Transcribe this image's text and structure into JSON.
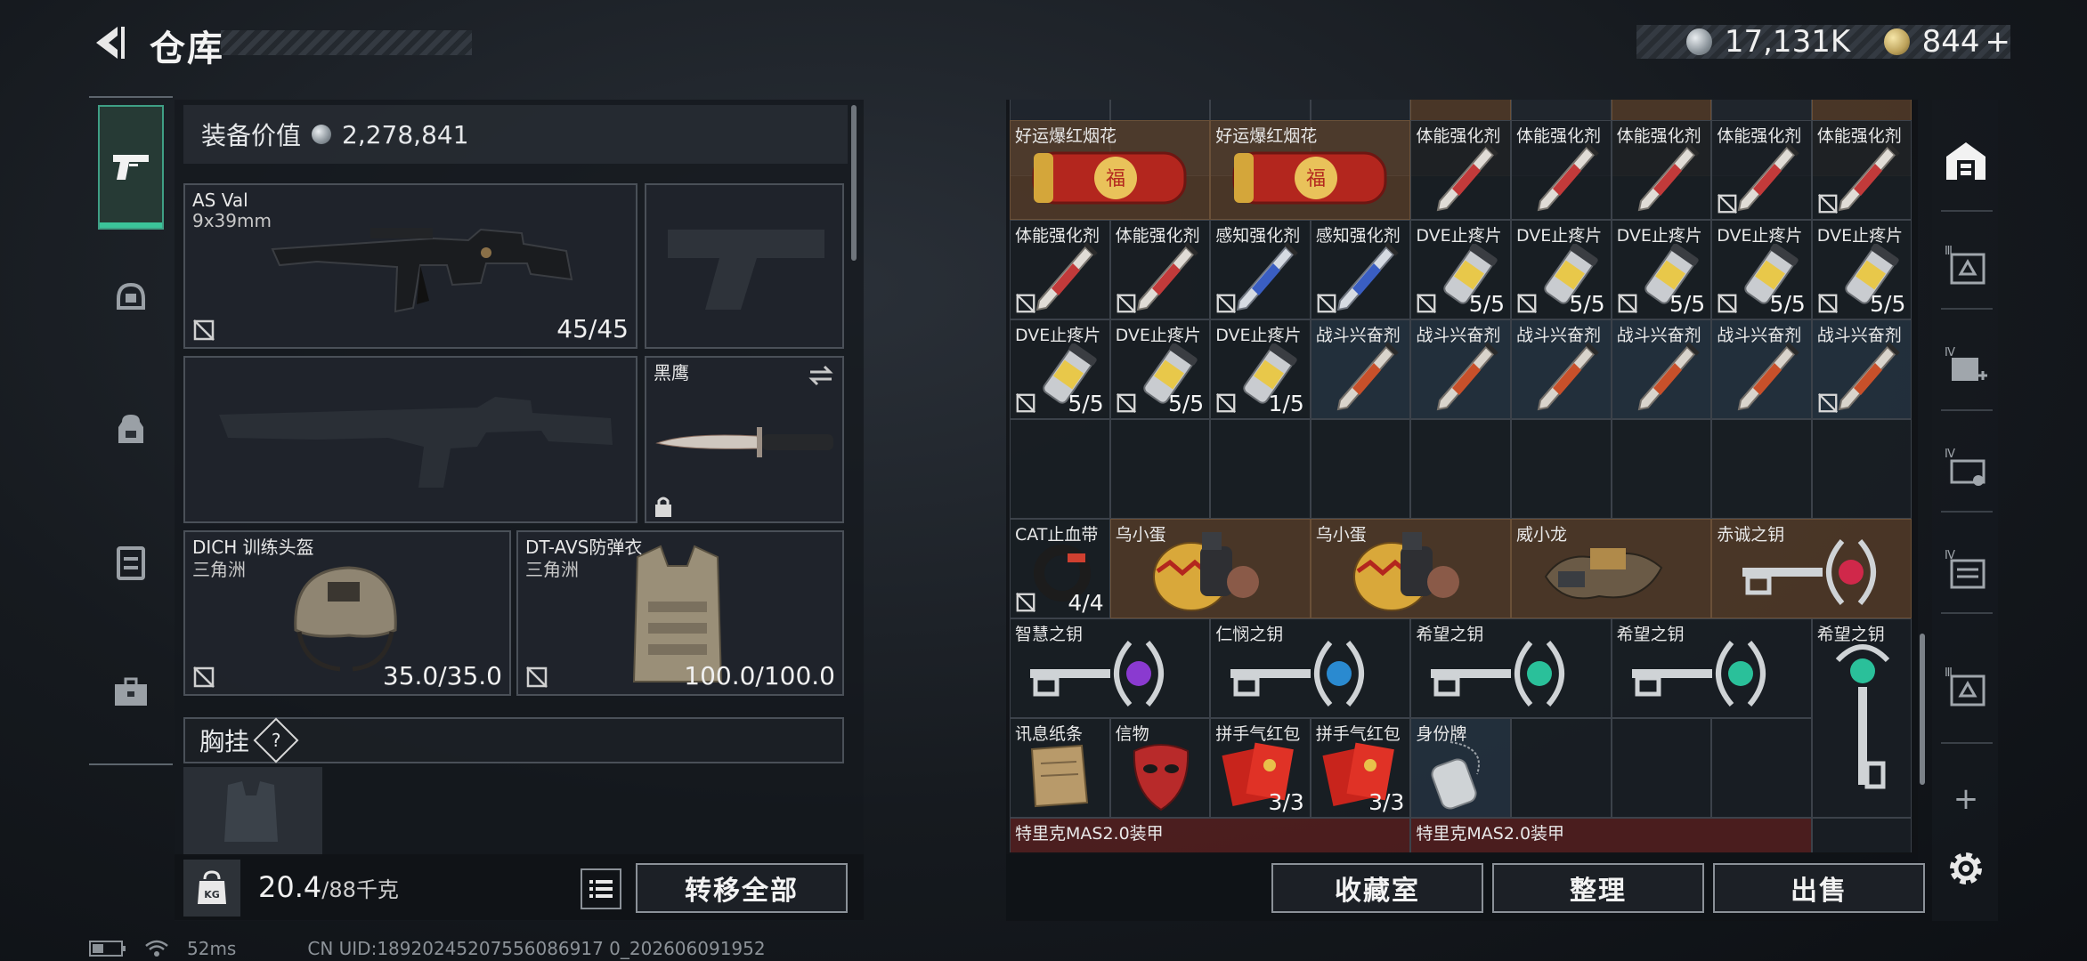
{
  "header": {
    "title": "仓库",
    "silver_amount": "17,131K",
    "gold_amount": "844",
    "gold_plus": "+"
  },
  "left_panel": {
    "equip_value_label": "装备价值",
    "equip_value": "2,278,841",
    "primary_weapon": {
      "name": "AS Val",
      "caliber": "9x39mm",
      "ammo": "45/45"
    },
    "melee": {
      "name": "黑鹰"
    },
    "helmet": {
      "name": "DICH 训练头盔",
      "map": "三角洲",
      "durability": "35.0/35.0"
    },
    "armor": {
      "name": "DT-AVS防弹衣",
      "map": "三角洲",
      "durability": "100.0/100.0"
    },
    "chest_rig_label": "胸挂",
    "chest_rig_help": "?",
    "weight_value": "20.4",
    "weight_max": "/88千克",
    "weight_icon_text": "KG",
    "transfer_all": "转移全部"
  },
  "grid": {
    "row0": [
      "",
      "",
      "",
      "",
      "",
      "",
      "",
      "",
      ""
    ],
    "row1": [
      {
        "label": "好运爆红烟花",
        "cnt": ""
      },
      {
        "label": "好运爆红烟花",
        "cnt": ""
      },
      {
        "label": "体能强化剂",
        "cnt": ""
      },
      {
        "label": "体能强化剂",
        "cnt": ""
      },
      {
        "label": "体能强化剂",
        "cnt": ""
      },
      {
        "label": "体能强化剂",
        "cnt": ""
      },
      {
        "label": "体能强化剂",
        "cnt": ""
      }
    ],
    "row2": [
      {
        "label": "体能强化剂",
        "cnt": ""
      },
      {
        "label": "体能强化剂",
        "cnt": ""
      },
      {
        "label": "感知强化剂",
        "cnt": ""
      },
      {
        "label": "感知强化剂",
        "cnt": ""
      },
      {
        "label": "DVE止疼片",
        "cnt": "5/5"
      },
      {
        "label": "DVE止疼片",
        "cnt": "5/5"
      },
      {
        "label": "DVE止疼片",
        "cnt": "5/5"
      },
      {
        "label": "DVE止疼片",
        "cnt": "5/5"
      },
      {
        "label": "DVE止疼片",
        "cnt": "5/5"
      }
    ],
    "row3": [
      {
        "label": "DVE止疼片",
        "cnt": "5/5"
      },
      {
        "label": "DVE止疼片",
        "cnt": "5/5"
      },
      {
        "label": "DVE止疼片",
        "cnt": "1/5"
      },
      {
        "label": "战斗兴奋剂",
        "cnt": ""
      },
      {
        "label": "战斗兴奋剂",
        "cnt": ""
      },
      {
        "label": "战斗兴奋剂",
        "cnt": ""
      },
      {
        "label": "战斗兴奋剂",
        "cnt": ""
      },
      {
        "label": "战斗兴奋剂",
        "cnt": ""
      },
      {
        "label": "战斗兴奋剂",
        "cnt": ""
      }
    ],
    "row5": [
      {
        "label": "CAT止血带",
        "cnt": "4/4"
      },
      {
        "label": "乌小蛋",
        "cnt": ""
      },
      {
        "label": "乌小蛋",
        "cnt": ""
      },
      {
        "label": "威小龙",
        "cnt": ""
      },
      {
        "label": "赤诚之钥",
        "cnt": ""
      }
    ],
    "row6": [
      {
        "label": "智慧之钥",
        "cnt": ""
      },
      {
        "label": "仁悯之钥",
        "cnt": ""
      },
      {
        "label": "希望之钥",
        "cnt": ""
      },
      {
        "label": "希望之钥",
        "cnt": ""
      },
      {
        "label": "希望之钥",
        "cnt": ""
      }
    ],
    "row7": [
      {
        "label": "讯息纸条",
        "cnt": ""
      },
      {
        "label": "信物",
        "cnt": ""
      },
      {
        "label": "拼手气红包",
        "cnt": "3/3"
      },
      {
        "label": "拼手气红包",
        "cnt": "3/3"
      },
      {
        "label": "身份牌",
        "cnt": ""
      }
    ],
    "row8": [
      {
        "label": "特里克MAS2.0装甲",
        "cnt": ""
      },
      {
        "label": "特里克MAS2.0装甲",
        "cnt": ""
      }
    ]
  },
  "right_buttons": {
    "collection": "收藏室",
    "organize": "整理",
    "sell": "出售"
  },
  "right_nav": {
    "tab_labels": [
      "Ⅲ",
      "Ⅳ",
      "Ⅳ",
      "Ⅳ",
      "Ⅲ"
    ],
    "add": "+"
  },
  "status_bar": {
    "ping": "52ms",
    "uid": "CN UID:18920245207556086917 0_202606091952"
  },
  "colors": {
    "accent_green": "#3bc49a",
    "panel_bg": "#14181d",
    "item_brown": "#5c422c",
    "item_red": "#642222"
  }
}
